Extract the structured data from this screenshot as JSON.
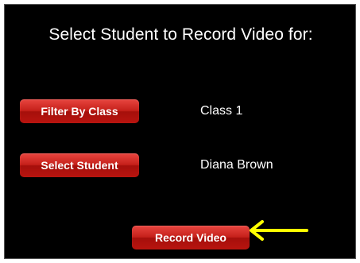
{
  "title": "Select Student to Record Video for:",
  "filter": {
    "button_label": "Filter By Class",
    "value": "Class 1"
  },
  "student": {
    "button_label": "Select Student",
    "value": "Diana Brown"
  },
  "record": {
    "button_label": "Record Video"
  },
  "colors": {
    "background": "#000000",
    "button": "#c5201a",
    "arrow": "#ffff00"
  },
  "icons": {
    "pointer": "arrow-left-icon"
  }
}
